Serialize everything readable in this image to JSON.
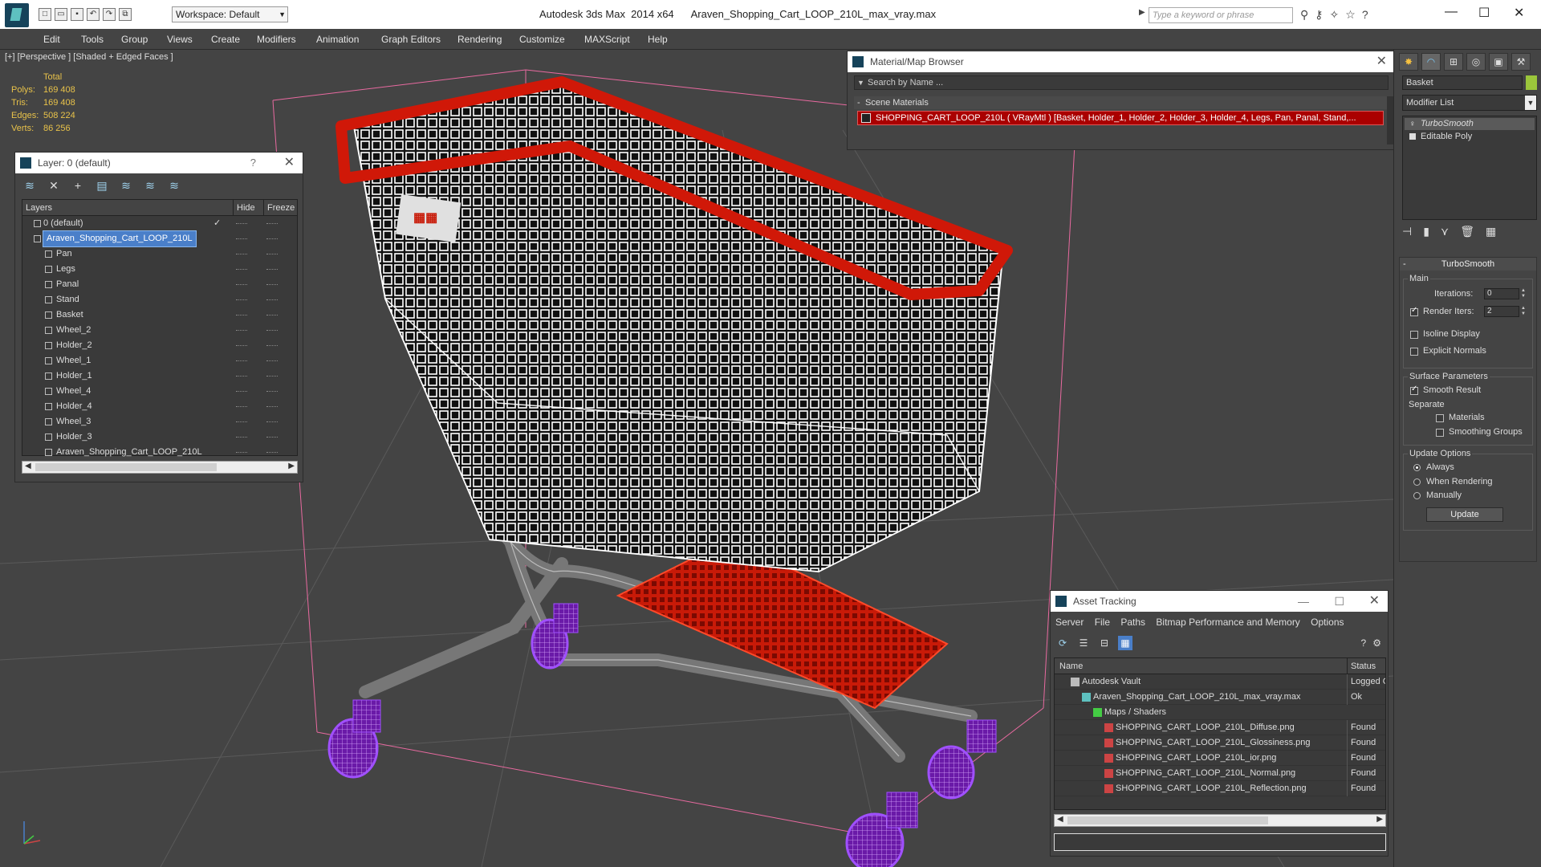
{
  "titlebar": {
    "app": "Autodesk 3ds Max  2014 x64",
    "file": "Araven_Shopping_Cart_LOOP_210L_max_vray.max",
    "workspace": "Workspace: Default",
    "search_placeholder": "Type a keyword or phrase"
  },
  "menu": [
    "Edit",
    "Tools",
    "Group",
    "Views",
    "Create",
    "Modifiers",
    "Animation",
    "Graph Editors",
    "Rendering",
    "Customize",
    "MAXScript",
    "Help"
  ],
  "viewport": {
    "label": "[+] [Perspective ] [Shaded + Edged Faces ]",
    "stats": {
      "header": "Total",
      "rows": [
        {
          "k": "Polys:",
          "v": "169 408"
        },
        {
          "k": "Tris:",
          "v": "169 408"
        },
        {
          "k": "Edges:",
          "v": "508 224"
        },
        {
          "k": "Verts:",
          "v": "86 256"
        }
      ]
    }
  },
  "layer_panel": {
    "title": "Layer: 0 (default)",
    "help": "?",
    "columns": {
      "layers": "Layers",
      "hide": "Hide",
      "freeze": "Freeze"
    },
    "rows": [
      {
        "name": "0 (default)",
        "indent": 0,
        "check": "✓"
      },
      {
        "name": "Araven_Shopping_Cart_LOOP_210L",
        "indent": 0,
        "selected": true
      },
      {
        "name": "Pan",
        "indent": 1
      },
      {
        "name": "Legs",
        "indent": 1
      },
      {
        "name": "Panal",
        "indent": 1
      },
      {
        "name": "Stand",
        "indent": 1
      },
      {
        "name": "Basket",
        "indent": 1
      },
      {
        "name": "Wheel_2",
        "indent": 1
      },
      {
        "name": "Holder_2",
        "indent": 1
      },
      {
        "name": "Wheel_1",
        "indent": 1
      },
      {
        "name": "Holder_1",
        "indent": 1
      },
      {
        "name": "Wheel_4",
        "indent": 1
      },
      {
        "name": "Holder_4",
        "indent": 1
      },
      {
        "name": "Wheel_3",
        "indent": 1
      },
      {
        "name": "Holder_3",
        "indent": 1
      },
      {
        "name": "Araven_Shopping_Cart_LOOP_210L",
        "indent": 1
      }
    ]
  },
  "material_browser": {
    "title": "Material/Map Browser",
    "search": "Search by Name ...",
    "section": "Scene Materials",
    "item": "SHOPPING_CART_LOOP_210L  ( VRayMtl ) [Basket, Holder_1, Holder_2, Holder_3, Holder_4, Legs, Pan, Panal, Stand,..."
  },
  "command_panel": {
    "object_name": "Basket",
    "object_color": "#9bc63b",
    "modifier_list": "Modifier List",
    "stack": [
      "TurboSmooth",
      "Editable Poly"
    ],
    "rollout": {
      "title": "TurboSmooth",
      "main_label": "Main",
      "iterations_label": "Iterations:",
      "iterations": "0",
      "render_iters_label": "Render Iters:",
      "render_iters": "2",
      "isoline": "Isoline Display",
      "explicit": "Explicit Normals",
      "surface_label": "Surface Parameters",
      "smooth": "Smooth Result",
      "separate": "Separate",
      "materials": "Materials",
      "smoothing_groups": "Smoothing Groups",
      "update_label": "Update Options",
      "always": "Always",
      "when_rendering": "When Rendering",
      "manually": "Manually",
      "update_btn": "Update"
    }
  },
  "asset_tracking": {
    "title": "Asset Tracking",
    "menu": [
      "Server",
      "File",
      "Paths",
      "Bitmap Performance and Memory",
      "Options"
    ],
    "columns": {
      "name": "Name",
      "status": "Status"
    },
    "rows": [
      {
        "name": "Autodesk Vault",
        "status": "Logged O",
        "indent": 0,
        "icon": "vault"
      },
      {
        "name": "Araven_Shopping_Cart_LOOP_210L_max_vray.max",
        "status": "Ok",
        "indent": 1,
        "icon": "max"
      },
      {
        "name": "Maps / Shaders",
        "status": "",
        "indent": 2,
        "icon": "maps"
      },
      {
        "name": "SHOPPING_CART_LOOP_210L_Diffuse.png",
        "status": "Found",
        "indent": 3,
        "icon": "png"
      },
      {
        "name": "SHOPPING_CART_LOOP_210L_Glossiness.png",
        "status": "Found",
        "indent": 3,
        "icon": "png"
      },
      {
        "name": "SHOPPING_CART_LOOP_210L_ior.png",
        "status": "Found",
        "indent": 3,
        "icon": "png"
      },
      {
        "name": "SHOPPING_CART_LOOP_210L_Normal.png",
        "status": "Found",
        "indent": 3,
        "icon": "png"
      },
      {
        "name": "SHOPPING_CART_LOOP_210L_Reflection.png",
        "status": "Found",
        "indent": 3,
        "icon": "png"
      }
    ]
  },
  "colors": {
    "cart_red": "#d01808",
    "wheel_purple": "#8a2be2",
    "wire_white": "#ffffff",
    "selection_blue": "#4a7fc9",
    "stat_yellow": "#e8c24a"
  }
}
